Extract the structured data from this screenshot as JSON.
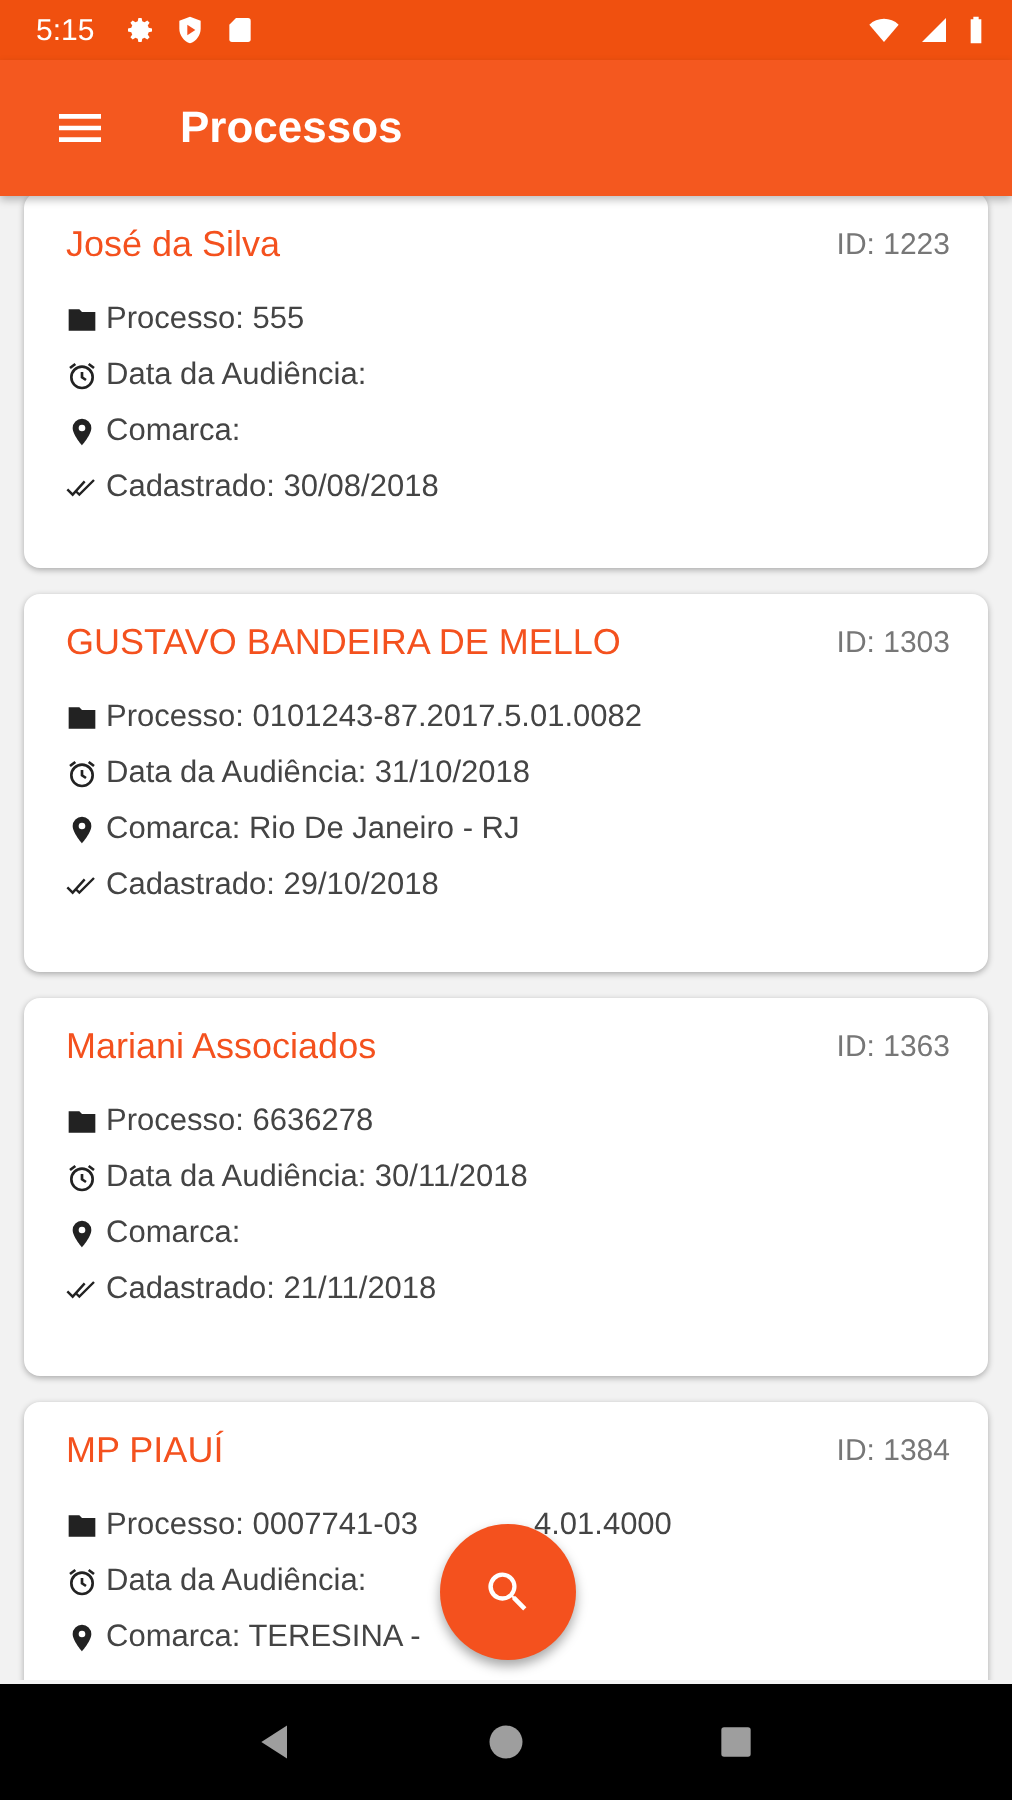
{
  "status_bar": {
    "time": "5:15"
  },
  "app_bar": {
    "title": "Processos"
  },
  "cards": [
    {
      "name": "José da Silva",
      "id": "ID: 1223",
      "lines": [
        {
          "kind": "process",
          "parts": [
            "Processo: 555"
          ]
        },
        {
          "kind": "hearing",
          "parts": [
            "Data da Audiência:"
          ]
        },
        {
          "kind": "location",
          "parts": [
            "Comarca:"
          ]
        },
        {
          "kind": "registered",
          "parts": [
            "Cadastrado: 30/08/2018"
          ]
        }
      ]
    },
    {
      "name": "GUSTAVO BANDEIRA DE MELLO",
      "id": "ID: 1303",
      "lines": [
        {
          "kind": "process",
          "parts": [
            "Processo: 0101243-87.2017.5.01.0082"
          ]
        },
        {
          "kind": "hearing",
          "parts": [
            "Data da Audiência: 31/10/2018"
          ]
        },
        {
          "kind": "location",
          "parts": [
            "Comarca: Rio De Janeiro - RJ"
          ]
        },
        {
          "kind": "registered",
          "parts": [
            "Cadastrado: 29/10/2018"
          ]
        }
      ]
    },
    {
      "name": "Mariani Associados",
      "id": "ID: 1363",
      "lines": [
        {
          "kind": "process",
          "parts": [
            "Processo: 6636278"
          ]
        },
        {
          "kind": "hearing",
          "parts": [
            "Data da Audiência: 30/11/2018"
          ]
        },
        {
          "kind": "location",
          "parts": [
            "Comarca:"
          ]
        },
        {
          "kind": "registered",
          "parts": [
            "Cadastrado: 21/11/2018"
          ]
        }
      ]
    },
    {
      "name": "MP PIAUÍ",
      "id": "ID: 1384",
      "lines": [
        {
          "kind": "process",
          "parts": [
            "Processo: 0007741-03",
            "4.01.4000"
          ]
        },
        {
          "kind": "hearing",
          "parts": [
            "Data da Audiência:"
          ]
        },
        {
          "kind": "location",
          "parts": [
            "Comarca: TERESINA -"
          ]
        }
      ]
    }
  ]
}
